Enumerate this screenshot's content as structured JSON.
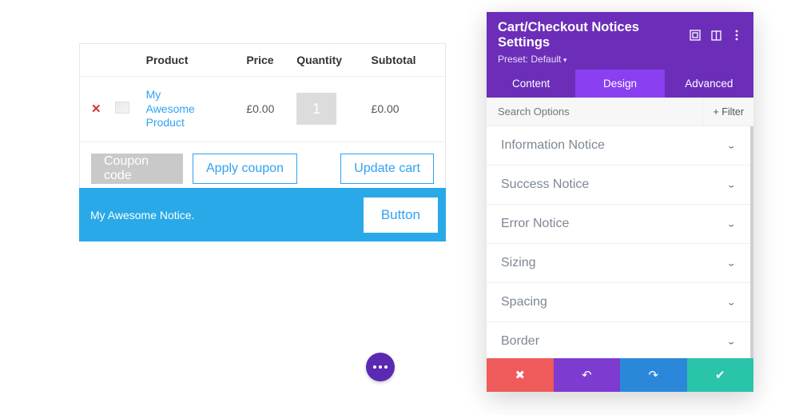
{
  "cart": {
    "headers": {
      "product": "Product",
      "price": "Price",
      "quantity": "Quantity",
      "subtotal": "Subtotal"
    },
    "row": {
      "product_name": "My Awesome Product",
      "price": "£0.00",
      "qty": "1",
      "subtotal": "£0.00"
    },
    "coupon_placeholder": "Coupon code",
    "apply_label": "Apply coupon",
    "update_label": "Update cart"
  },
  "notice": {
    "text": "My Awesome Notice.",
    "button_label": "Button"
  },
  "panel": {
    "title": "Cart/Checkout Notices Settings",
    "preset": "Preset: Default",
    "tabs": {
      "content": "Content",
      "design": "Design",
      "advanced": "Advanced"
    },
    "search_placeholder": "Search Options",
    "filter_label": "Filter",
    "sections": {
      "info": "Information Notice",
      "success": "Success Notice",
      "error": "Error Notice",
      "sizing": "Sizing",
      "spacing": "Spacing",
      "border": "Border"
    }
  }
}
